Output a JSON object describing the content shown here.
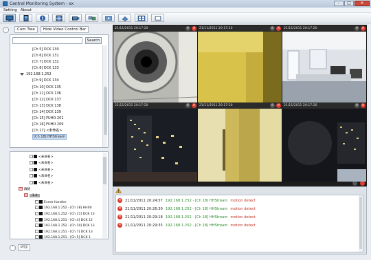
{
  "window": {
    "title": "Central Monitoring System - xx"
  },
  "menu": [
    "Setting",
    "About"
  ],
  "colors": {
    "accent": "#2a6fb0",
    "alarm": "#d93a2e",
    "ip_green": "#2c8b2c",
    "msg_red": "#c03020"
  },
  "toolbar": {
    "buttons": [
      {
        "icon": "monitor-icon"
      },
      {
        "icon": "panel-icon"
      },
      {
        "icon": "alert-icon"
      },
      {
        "icon": "grid-icon"
      },
      {
        "icon": "camera-icon"
      },
      {
        "icon": "network-icon"
      },
      {
        "icon": "playback-icon"
      },
      {
        "icon": "storage-icon"
      },
      {
        "icon": "layout-icon"
      },
      {
        "icon": "record-icon"
      }
    ]
  },
  "left": {
    "tab_cam_tree": "Cam Tree",
    "tab_hide_video": "Hide Video Control Bar",
    "search": {
      "value": "",
      "button": "Search"
    },
    "tree": [
      {
        "label": "[Ch 5] DCK 130",
        "kind": "ch"
      },
      {
        "label": "[Ch 6] DCK 131",
        "kind": "ch"
      },
      {
        "label": "[Ch 7] DCK 132",
        "kind": "ch"
      },
      {
        "label": "[Ch 8] DCK 133",
        "kind": "ch"
      },
      {
        "label": "192.168.1.252",
        "kind": "grp"
      },
      {
        "label": "[Ch 9] DCK 134",
        "kind": "ch"
      },
      {
        "label": "[Ch 10] DCK 135",
        "kind": "ch"
      },
      {
        "label": "[Ch 11] DCK 136",
        "kind": "ch"
      },
      {
        "label": "[Ch 12] DCK 137",
        "kind": "ch"
      },
      {
        "label": "[Ch 13] DCK 138",
        "kind": "ch"
      },
      {
        "label": "[Ch 14] DCK 139",
        "kind": "ch"
      },
      {
        "label": "[Ch 15] FUHO 201",
        "kind": "ch"
      },
      {
        "label": "[Ch 16] FUHO 209",
        "kind": "ch"
      },
      {
        "label": "[Ch 17] <未命名>",
        "kind": "ch"
      },
      {
        "label": "[Ch 18] HHStream",
        "kind": "sel"
      }
    ],
    "tree2": [
      {
        "label": "<未命名>",
        "kind": "leaf"
      },
      {
        "label": "<未命名>",
        "kind": "leaf"
      },
      {
        "label": "<未命名>",
        "kind": "leaf"
      },
      {
        "label": "<未命名>",
        "kind": "leaf"
      },
      {
        "label": "<未命名>",
        "kind": "leaf"
      },
      {
        "label": "群組",
        "kind": "grp"
      },
      {
        "label": "1.4",
        "kind": "sub"
      },
      {
        "label": "Event Handler",
        "kind": "ev"
      },
      {
        "label": "192.168.1.252 - [Ch 18] HHStr",
        "kind": "ev"
      },
      {
        "label": "192.168.1.252 - [Ch 11] DCK 13",
        "kind": "ev"
      },
      {
        "label": "192.168.1.251 - [Ch 4] DCK 12",
        "kind": "ev"
      },
      {
        "label": "192.168.1.252 - [Ch 10] DCK 13",
        "kind": "ev"
      },
      {
        "label": "192.168.1.251 - [Ch 7] DCK 13",
        "kind": "ev"
      },
      {
        "label": "192.168.1.251 - [Ch 5] DCK 1",
        "kind": "ev"
      }
    ],
    "ptz": "PTZ"
  },
  "cameras": [
    {
      "ts": "21/11/2011 20:17:20",
      "scene": "dome"
    },
    {
      "ts": "21/11/2011 20:17:20",
      "scene": "yellow"
    },
    {
      "ts": "21/11/2011 20:17:20",
      "scene": "office"
    },
    {
      "ts": "21/11/2011 20:17:20",
      "scene": "city"
    },
    {
      "ts": "21/11/2011 20:17:20",
      "scene": "yellow2"
    },
    {
      "ts": "21/11/2011 20:17:20",
      "scene": "night"
    }
  ],
  "events": [
    {
      "time": "21/11/2011 20:24:57",
      "source": "192.168.1.252 - [Ch 18] HHStream",
      "msg": "motion detect"
    },
    {
      "time": "21/11/2011 20:26:30",
      "source": "192.168.1.252 - [Ch 18] HHStream",
      "msg": "motion detect"
    },
    {
      "time": "21/11/2011 20:29:18",
      "source": "192.168.1.252 - [Ch 18] HHStream",
      "msg": "motion detect"
    },
    {
      "time": "21/11/2011 20:29:35",
      "source": "192.168.1.252 - [Ch 18] HHStream",
      "msg": "motion detect"
    }
  ]
}
